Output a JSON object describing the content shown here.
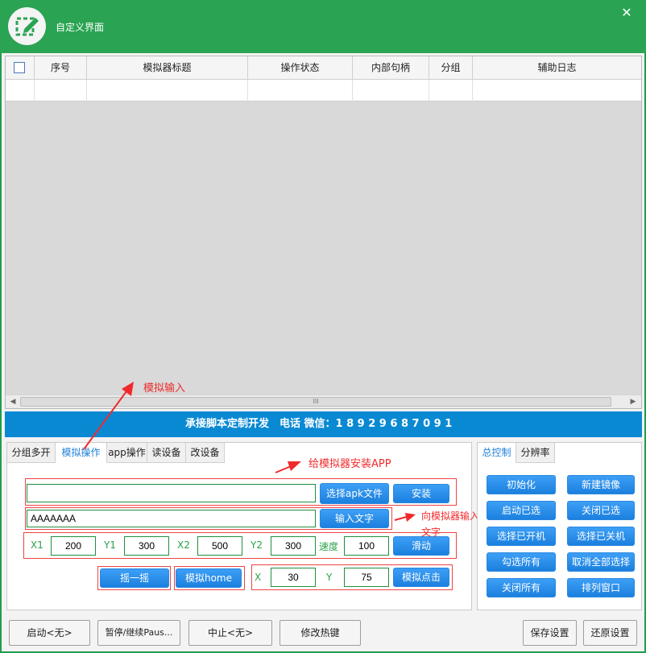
{
  "window": {
    "title": "自定义界面"
  },
  "table": {
    "headers": [
      "序号",
      "模拟器标题",
      "操作状态",
      "内部句柄",
      "分组",
      "辅助日志"
    ],
    "scroll_grip": "III"
  },
  "banner": {
    "text": "承接脚本定制开发　电话 微信：1 8 9 2 9 6 8 7 0 9 1"
  },
  "left_tabs": [
    "分组多开",
    "模拟操作",
    "app操作",
    "读设备",
    "改设备"
  ],
  "apk": {
    "path_value": "",
    "choose_label": "选择apk文件",
    "install_label": "安装"
  },
  "text_input": {
    "value": "AAAAAAA",
    "button_label": "输入文字"
  },
  "swipe": {
    "x1_label": "X1",
    "x1_value": "200",
    "y1_label": "Y1",
    "y1_value": "300",
    "x2_label": "X2",
    "x2_value": "500",
    "y2_label": "Y2",
    "y2_value": "300",
    "speed_label": "速度",
    "speed_value": "100",
    "button_label": "滑动"
  },
  "misc": {
    "shake_label": "摇一摇",
    "home_label": "模拟home"
  },
  "click": {
    "x_label": "X",
    "x_value": "30",
    "y_label": "Y",
    "y_value": "75",
    "button_label": "模拟点击"
  },
  "annotations": {
    "sim_input": "模拟输入",
    "install_app": "给模拟器安装APP",
    "send_text_1": "向模拟器输入",
    "send_text_2": "文字"
  },
  "right_tabs": [
    "总控制",
    "分辨率"
  ],
  "right_buttons": [
    "初始化",
    "新建镜像",
    "启动已选",
    "关闭已选",
    "选择已开机",
    "选择已关机",
    "勾选所有",
    "取消全部选择",
    "关闭所有",
    "排列窗口"
  ],
  "bottom": {
    "start_label": "启动<无>",
    "pause_label": "暂停/继续Paus...",
    "stop_label": "中止<无>",
    "hotkey_label": "修改热键",
    "save_label": "保存设置",
    "restore_label": "还原设置"
  },
  "colors": {
    "title_green": "#2aa452",
    "accent_blue": "#1b80de",
    "annotation_red": "#f02a2a"
  }
}
